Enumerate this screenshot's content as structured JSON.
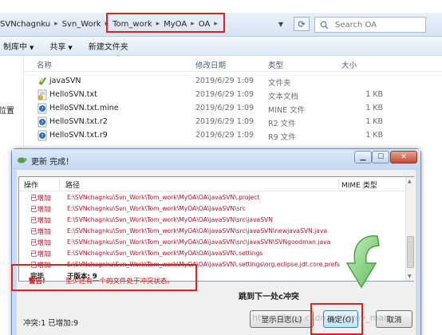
{
  "explorer": {
    "breadcrumb": [
      "SVNchagnku",
      "Svn_Work",
      "Tom_work",
      "MyOA",
      "OA"
    ],
    "search_placeholder": "Search OA",
    "commands": [
      "制库中",
      "共享",
      "新建文件夹"
    ],
    "nav_label": "位置",
    "columns": {
      "name": "名称",
      "date": "修改日期",
      "type": "类型",
      "size": "大小"
    },
    "files": [
      {
        "name": "javaSVN",
        "date": "2019/6/29 1:09",
        "type": "文件夹",
        "size": "",
        "icon": "svn-folder-icon"
      },
      {
        "name": "HelloSVN.txt",
        "date": "2019/6/29 1:09",
        "type": "文本文档",
        "size": "1 KB",
        "icon": "conflict-file-icon"
      },
      {
        "name": "HelloSVN.txt.mine",
        "date": "2019/6/29 1:09",
        "type": "MINE 文件",
        "size": "1 KB",
        "icon": "unknown-file-icon"
      },
      {
        "name": "HelloSVN.txt.r2",
        "date": "2019/6/29 1:09",
        "type": "R2 文件",
        "size": "1 KB",
        "icon": "unknown-file-icon"
      },
      {
        "name": "HelloSVN.txt.r9",
        "date": "2019/6/29 1:09",
        "type": "R9 文件",
        "size": "1 KB",
        "icon": "unknown-file-icon"
      }
    ]
  },
  "dialog": {
    "title": "更新 完成！",
    "columns": {
      "action": "操作",
      "path": "路径",
      "mime": "MIME 类型"
    },
    "log": [
      {
        "action": "已增加",
        "path": "E:\\SVNchagnku\\Svn_Work\\Tom_work\\MyOA\\OA\\javaSVN\\.project",
        "kind": "added"
      },
      {
        "action": "已增加",
        "path": "E:\\SVNchagnku\\Svn_Work\\Tom_work\\MyOA\\OA\\javaSVN\\src",
        "kind": "added"
      },
      {
        "action": "已增加",
        "path": "E:\\SVNchagnku\\Svn_Work\\Tom_work\\MyOA\\OA\\javaSVN\\src\\javaSVN",
        "kind": "added"
      },
      {
        "action": "已增加",
        "path": "E:\\SVNchagnku\\Svn_Work\\Tom_work\\MyOA\\OA\\javaSVN\\src\\javaSVN\\newjavaSVN.java",
        "kind": "added"
      },
      {
        "action": "已增加",
        "path": "E:\\SVNchagnku\\Svn_Work\\Tom_work\\MyOA\\OA\\javaSVN\\src\\javaSVN\\SVNgoodman.java",
        "kind": "added"
      },
      {
        "action": "已增加",
        "path": "E:\\SVNchagnku\\Svn_Work\\Tom_work\\MyOA\\OA\\javaSVN\\.settings",
        "kind": "added"
      },
      {
        "action": "已增加",
        "path": "E:\\SVNchagnku\\Svn_Work\\Tom_work\\MyOA\\OA\\javaSVN\\.settings\\org.eclipse.jdt.core.prefs",
        "kind": "added"
      },
      {
        "action": "完毕",
        "path": "于版本: 9",
        "kind": "done"
      },
      {
        "action": "警告!",
        "path": "至少还有一个的文件处于冲突状态。",
        "kind": "warn"
      }
    ],
    "jump_label": "跳到下一处c冲突",
    "status": "冲突:1 已增加:9",
    "buttons": {
      "show_log": "显示日志(L)",
      "ok": "确定(O)",
      "cancel": "取消"
    }
  },
  "watermark": "https://blog.csdn.net/grey_man",
  "colors": {
    "added": "#b01530",
    "warn": "#d01010",
    "highlight_box": "#e32020",
    "arrow": "#7ed07a"
  }
}
